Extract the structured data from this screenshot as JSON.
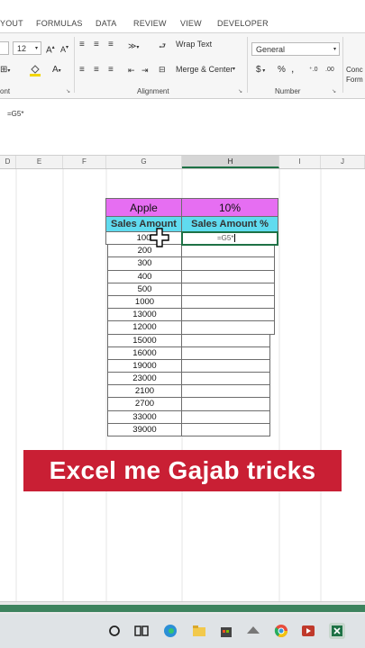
{
  "ribbon": {
    "tabs": [
      "YOUT",
      "FORMULAS",
      "DATA",
      "REVIEW",
      "VIEW",
      "DEVELOPER"
    ],
    "font_size": "12",
    "wrap_text": "Wrap Text",
    "merge_center": "Merge & Center",
    "number_format": "General",
    "currency": "$",
    "percent": "%",
    "comma": ",",
    "conditional_line1": "Conc",
    "conditional_line2": "Form",
    "groups": {
      "font": "ont",
      "alignment": "Alignment",
      "number": "Number"
    }
  },
  "formula_bar": {
    "value": "=G5*"
  },
  "columns": [
    "D",
    "E",
    "F",
    "G",
    "H",
    "I",
    "J"
  ],
  "table": {
    "title_left": "Apple",
    "title_right": "10%",
    "header_left": "Sales Amount",
    "header_right": "Sales Amount %",
    "editing_cell": "=G5*",
    "values": [
      "100",
      "200",
      "300",
      "400",
      "500",
      "1000",
      "13000",
      "12000",
      "15000",
      "16000",
      "19000",
      "23000",
      "2100",
      "2700",
      "33000",
      "39000"
    ]
  },
  "banner": "Excel me Gajab tricks",
  "colors": {
    "title_fill": "#e66ef2",
    "header_fill": "#60dbef",
    "banner": "#c91f34",
    "excel_green": "#1e7145"
  }
}
